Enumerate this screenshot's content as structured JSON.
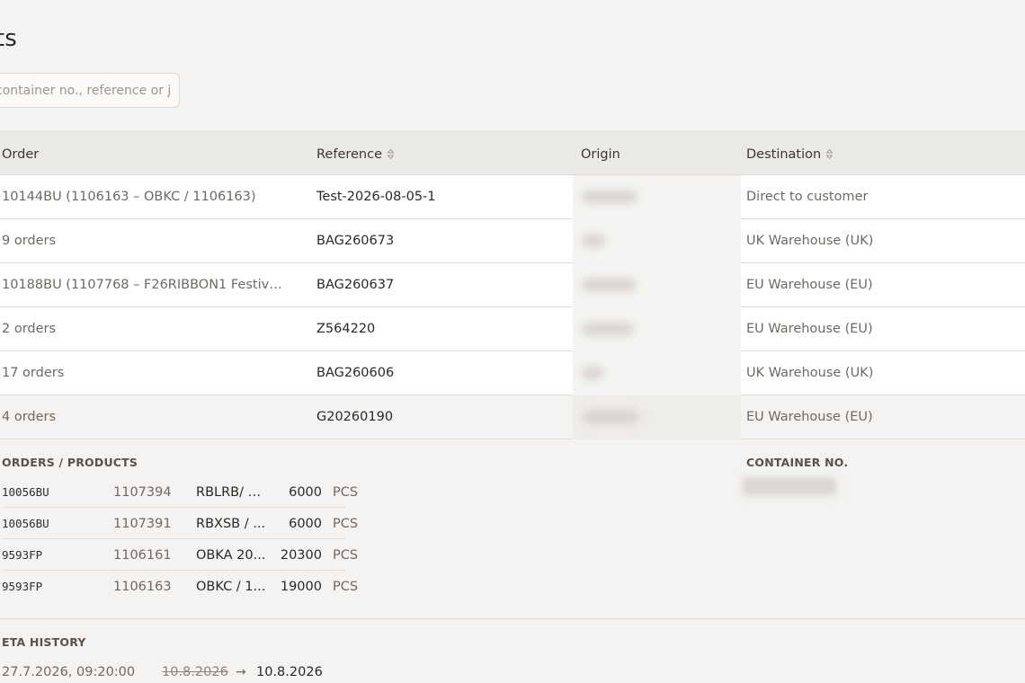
{
  "page": {
    "title": "ents"
  },
  "search": {
    "placeholder": "container no., reference or j"
  },
  "table": {
    "headers": {
      "order": "Order",
      "reference": "Reference",
      "origin": "Origin",
      "destination": "Destination"
    },
    "rows": [
      {
        "order": "10144BU (1106163 – OBKC / 1106163)",
        "reference": "Test-2026-08-05-1",
        "destination": "Direct to customer"
      },
      {
        "order": "9 orders",
        "reference": "BAG260673",
        "destination": "UK Warehouse (UK)"
      },
      {
        "order": "10188BU (1107768 – F26RIBBON1 Festive …",
        "reference": "BAG260637",
        "destination": "EU Warehouse (EU)"
      },
      {
        "order": "2 orders",
        "reference": "Z564220",
        "destination": "EU Warehouse (EU)"
      },
      {
        "order": "17 orders",
        "reference": "BAG260606",
        "destination": "UK Warehouse (UK)"
      },
      {
        "order": "4 orders",
        "reference": "G20260190",
        "destination": "EU Warehouse (EU)"
      }
    ]
  },
  "details": {
    "orders_label": "ORDERS / PRODUCTS",
    "container_label": "CONTAINER NO.",
    "products": [
      {
        "code": "10056BU",
        "number": "1107394",
        "name": "RBLRB/ 1...",
        "qty": "6000",
        "unit": "PCS"
      },
      {
        "code": "10056BU",
        "number": "1107391",
        "name": "RBXSB / ...",
        "qty": "6000",
        "unit": "PCS"
      },
      {
        "code": "9593FP",
        "number": "1106161",
        "name": "OBKA 20...",
        "qty": "20300",
        "unit": "PCS"
      },
      {
        "code": "9593FP",
        "number": "1106163",
        "name": "OBKC / 1...",
        "qty": "19000",
        "unit": "PCS"
      }
    ]
  },
  "eta_history": {
    "label": "ETA HISTORY",
    "timestamp": "27.7.2026, 09:20:00",
    "old_date": "10.8.2026",
    "arrow": "→",
    "new_date": "10.8.2026"
  }
}
